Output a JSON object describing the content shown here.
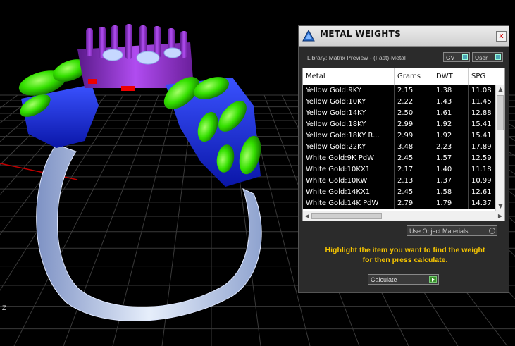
{
  "panel": {
    "title": "METAL WEIGHTS",
    "close_label": "x",
    "library_label": "Library: Matrix Preview - (Fast)-Metal",
    "gv_label": "GV",
    "user_label": "User",
    "use_object_materials_label": "Use Object Materials",
    "instruction_line1": "Highlight the item you want to find the weight",
    "instruction_line2": "for then press calculate.",
    "calculate_label": "Calculate"
  },
  "table": {
    "columns": [
      "Metal",
      "Grams",
      "DWT",
      "SPG"
    ],
    "rows": [
      [
        "Yellow Gold:9KY",
        "2.15",
        "1.38",
        "11.08"
      ],
      [
        "Yellow Gold:10KY",
        "2.22",
        "1.43",
        "11.45"
      ],
      [
        "Yellow Gold:14KY",
        "2.50",
        "1.61",
        "12.88"
      ],
      [
        "Yellow Gold:18KY",
        "2.99",
        "1.92",
        "15.41"
      ],
      [
        "Yellow Gold:18KY R...",
        "2.99",
        "1.92",
        "15.41"
      ],
      [
        "Yellow Gold:22KY",
        "3.48",
        "2.23",
        "17.89"
      ],
      [
        "White Gold:9K PdW",
        "2.45",
        "1.57",
        "12.59"
      ],
      [
        "White Gold:10KX1",
        "2.17",
        "1.40",
        "11.18"
      ],
      [
        "White Gold:10KW",
        "2.13",
        "1.37",
        "10.99"
      ],
      [
        "White Gold:14KX1",
        "2.45",
        "1.58",
        "12.61"
      ],
      [
        "White Gold:14K PdW",
        "2.79",
        "1.79",
        "14.37"
      ]
    ]
  },
  "viewport": {
    "axis_label": "Z",
    "colors": {
      "leaf": "#32e000",
      "setting": "#1a2ce8",
      "prongs": "#8a2ac8",
      "shank": "#c8d8f0",
      "grid": "#3a3a3a",
      "axis_x": "#c00000"
    }
  }
}
